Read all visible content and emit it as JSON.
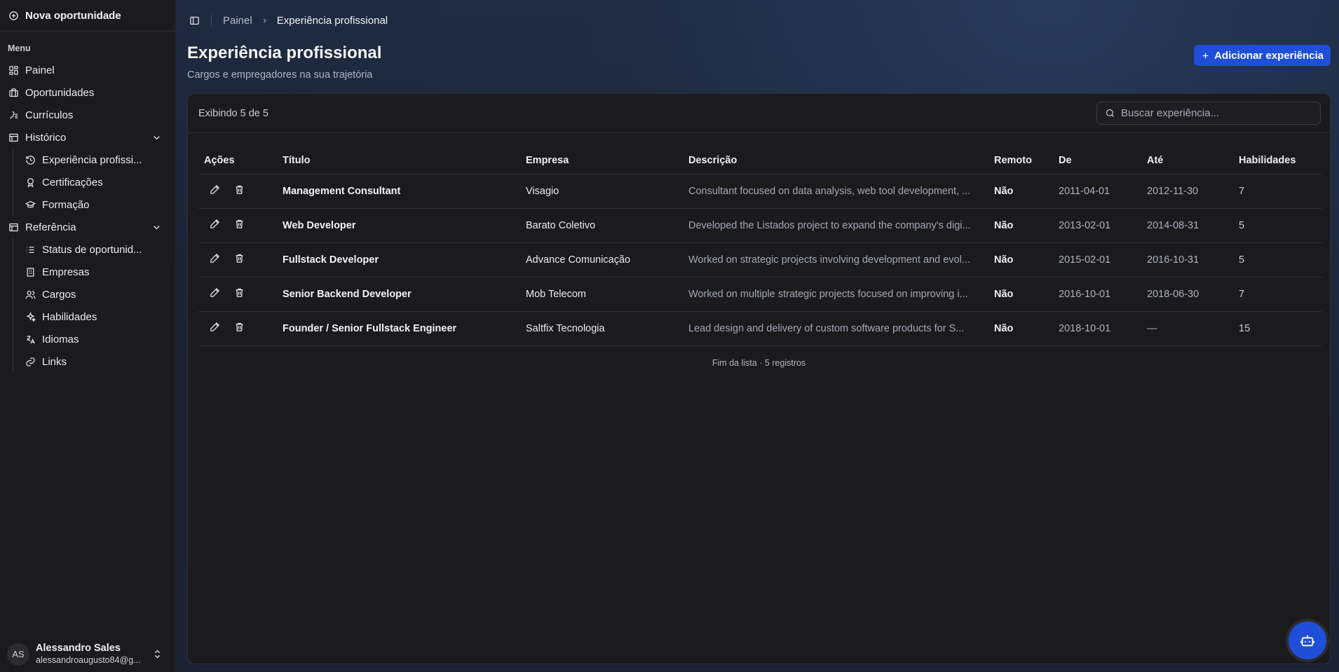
{
  "sidebar": {
    "new_opportunity": "Nova oportunidade",
    "menu_label": "Menu",
    "items": [
      {
        "label": "Painel",
        "icon": "dashboard-icon"
      },
      {
        "label": "Oportunidades",
        "icon": "briefcase-icon"
      },
      {
        "label": "Currículos",
        "icon": "file-icon"
      },
      {
        "label": "Histórico",
        "icon": "history-icon"
      }
    ],
    "historico_sub": [
      {
        "label": "Experiência profissi...",
        "icon": "history-icon"
      },
      {
        "label": "Certificações",
        "icon": "award-icon"
      },
      {
        "label": "Formação",
        "icon": "graduation-cap-icon"
      }
    ],
    "referencia_label": "Referência",
    "referencia_sub": [
      {
        "label": "Status de oportunid...",
        "icon": "list-icon"
      },
      {
        "label": "Empresas",
        "icon": "building-icon"
      },
      {
        "label": "Cargos",
        "icon": "users-icon"
      },
      {
        "label": "Habilidades",
        "icon": "sparkles-icon"
      },
      {
        "label": "Idiomas",
        "icon": "languages-icon"
      },
      {
        "label": "Links",
        "icon": "link-icon"
      }
    ],
    "user": {
      "initials": "AS",
      "name": "Alessandro Sales",
      "email": "alessandroaugusto84@g..."
    }
  },
  "breadcrumb": {
    "root": "Painel",
    "current": "Experiência profissional"
  },
  "header": {
    "title": "Experiência profissional",
    "subtitle": "Cargos e empregadores na sua trajetória",
    "add_button": "Adicionar experiência"
  },
  "list": {
    "count_text": "Exibindo 5 de 5",
    "search_placeholder": "Buscar experiência...",
    "columns": [
      "Ações",
      "Título",
      "Empresa",
      "Descrição",
      "Remoto",
      "De",
      "Até",
      "Habilidades"
    ],
    "rows": [
      {
        "title": "Management Consultant",
        "company": "Visagio",
        "description": "Consultant focused on data analysis, web tool development, ...",
        "remote": "Não",
        "from": "2011-04-01",
        "to": "2012-11-30",
        "skills": "7"
      },
      {
        "title": "Web Developer",
        "company": "Barato Coletivo",
        "description": "Developed the Listados project to expand the company's digi...",
        "remote": "Não",
        "from": "2013-02-01",
        "to": "2014-08-31",
        "skills": "5"
      },
      {
        "title": "Fullstack Developer",
        "company": "Advance Comunicação",
        "description": "Worked on strategic projects involving development and evol...",
        "remote": "Não",
        "from": "2015-02-01",
        "to": "2016-10-31",
        "skills": "5"
      },
      {
        "title": "Senior Backend Developer",
        "company": "Mob Telecom",
        "description": "Worked on multiple strategic projects focused on improving i...",
        "remote": "Não",
        "from": "2016-10-01",
        "to": "2018-06-30",
        "skills": "7"
      },
      {
        "title": "Founder / Senior Fullstack Engineer",
        "company": "Saltfix Tecnologia",
        "description": "Lead design and delivery of custom software products for S...",
        "remote": "Não",
        "from": "2018-10-01",
        "to": "—",
        "skills": "15"
      }
    ],
    "footer_text": "Fim da lista · 5 registros"
  },
  "colors": {
    "accent": "#1f4fd8",
    "background": "#1b1b1e"
  }
}
